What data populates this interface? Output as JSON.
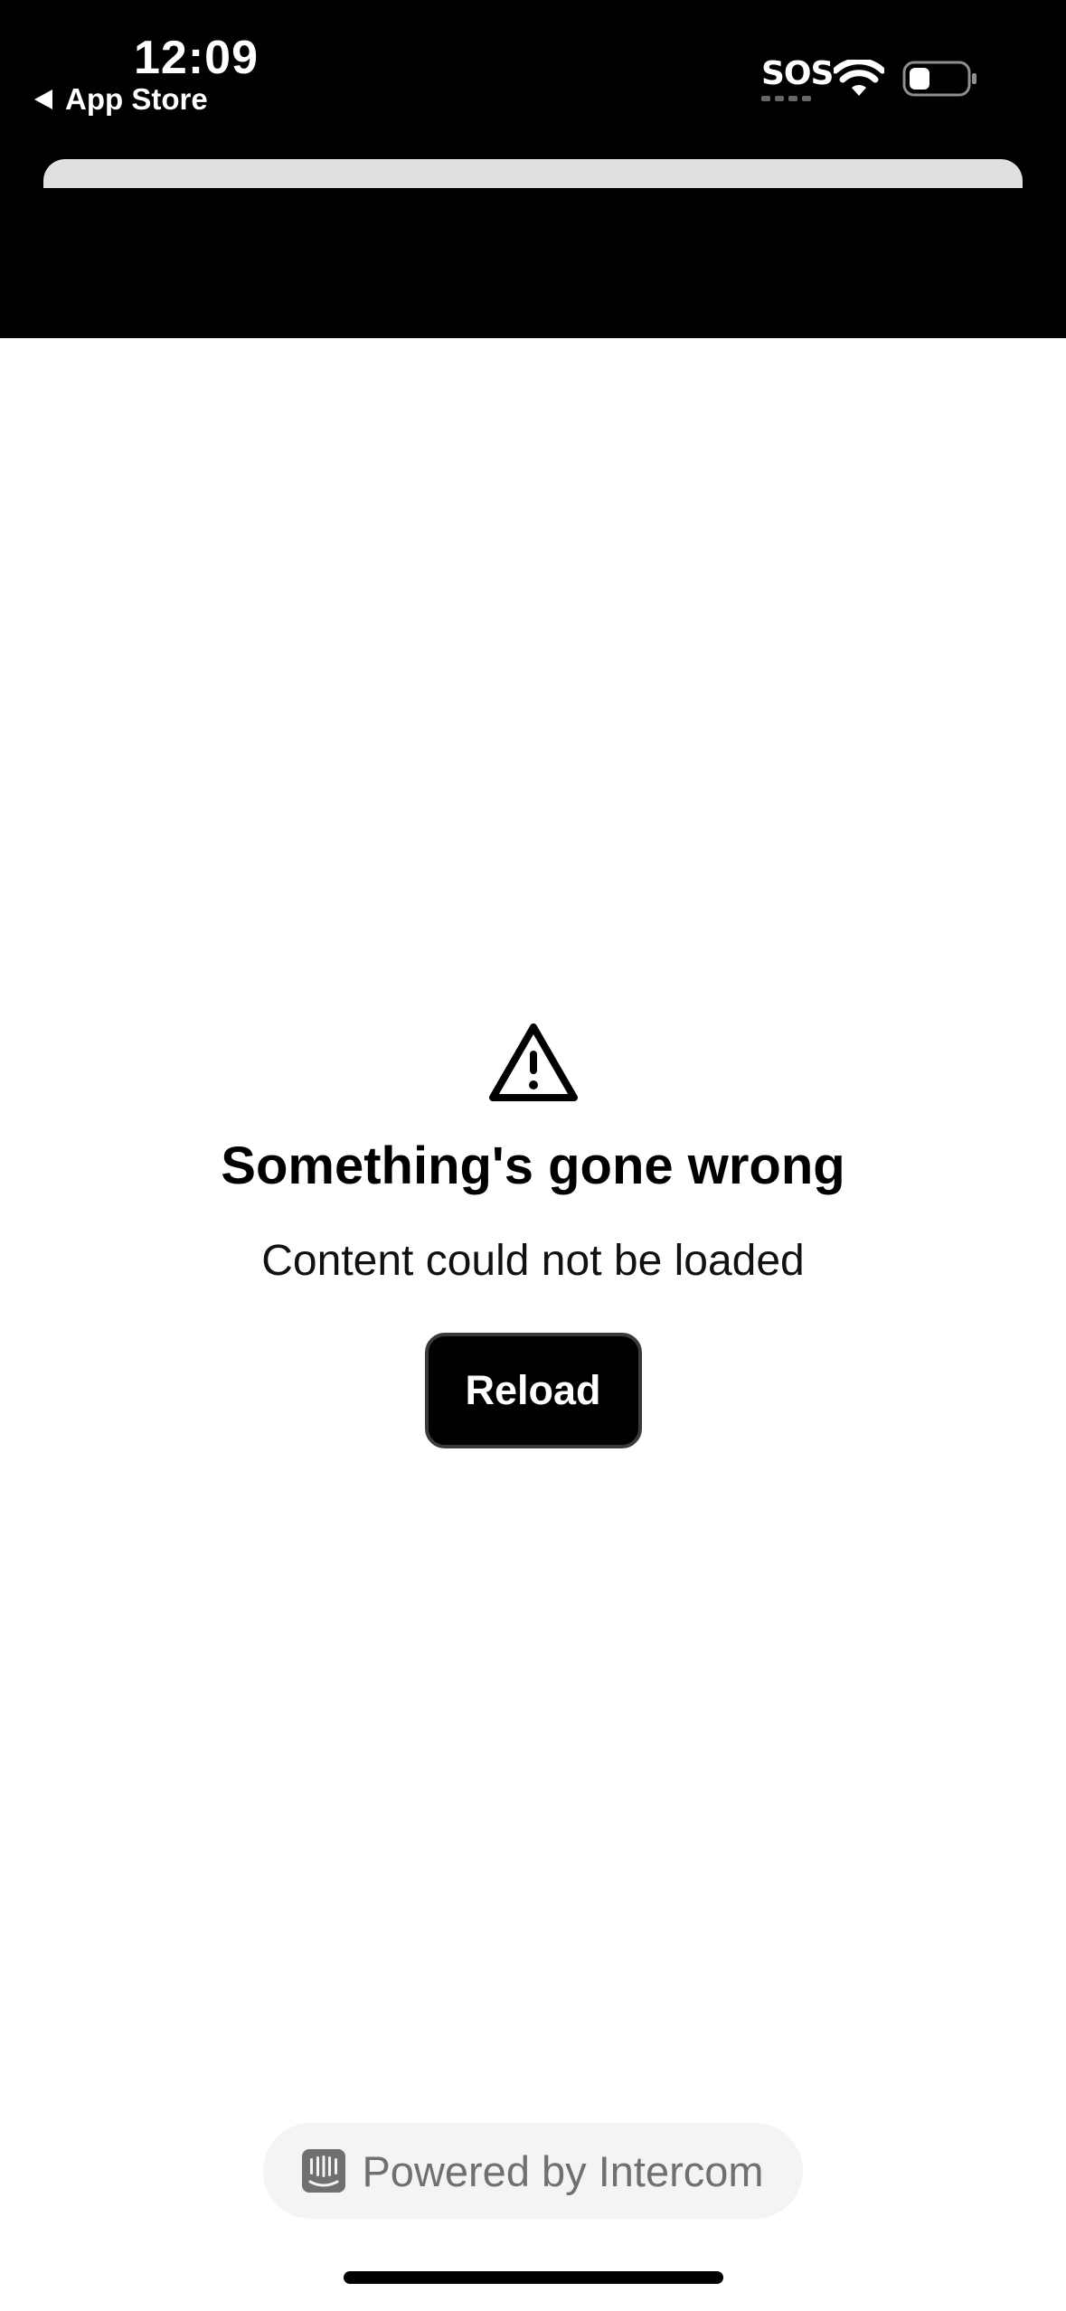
{
  "status_bar": {
    "time": "12:09",
    "back_label": "App Store",
    "sos": "SOS"
  },
  "error": {
    "title": "Something's gone wrong",
    "message": "Content could not be loaded",
    "reload_label": "Reload"
  },
  "footer": {
    "powered_by": "Powered by Intercom"
  },
  "icons": {
    "warning": "warning-triangle-icon",
    "wifi": "wifi-icon",
    "battery": "battery-icon",
    "intercom": "intercom-logo-icon"
  },
  "colors": {
    "header_bg": "#000000",
    "button_bg": "#000000",
    "pill_bg": "#f4f4f4",
    "pill_text": "#707070"
  }
}
